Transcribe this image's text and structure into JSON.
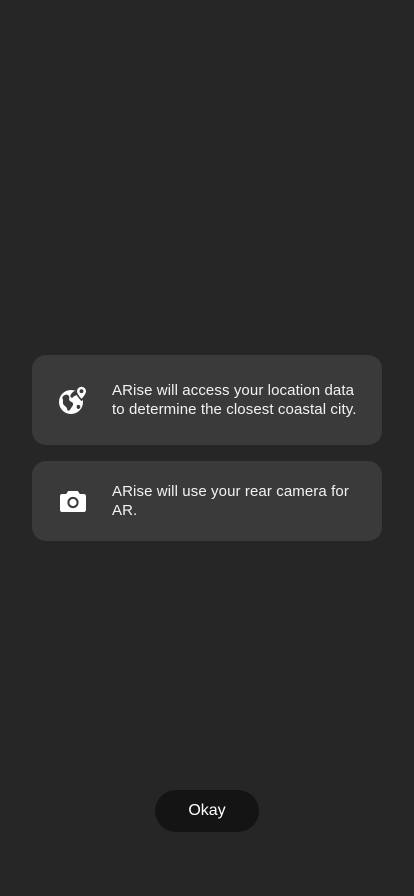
{
  "permissions": [
    {
      "icon": "globe-location-icon",
      "text": "ARise will access your location data to determine the closest coastal city."
    },
    {
      "icon": "camera-icon",
      "text": "ARise will use your rear camera for AR."
    }
  ],
  "actions": {
    "okay_label": "Okay"
  },
  "colors": {
    "background": "#262626",
    "card": "#3a3a3a",
    "button": "#141414",
    "text": "#ffffff"
  }
}
